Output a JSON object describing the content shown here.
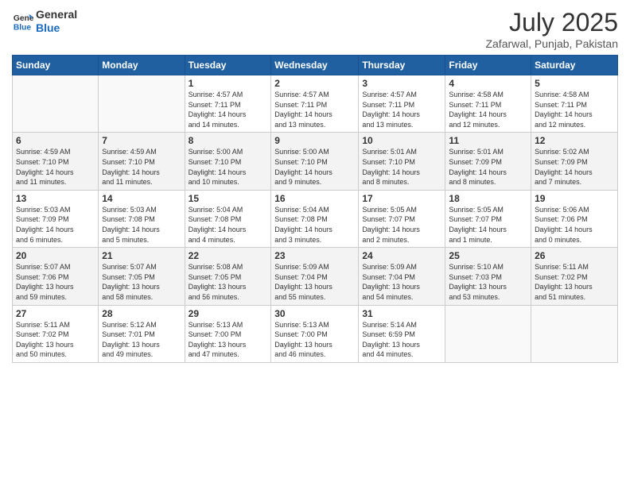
{
  "header": {
    "logo_line1": "General",
    "logo_line2": "Blue",
    "month_year": "July 2025",
    "location": "Zafarwal, Punjab, Pakistan"
  },
  "weekdays": [
    "Sunday",
    "Monday",
    "Tuesday",
    "Wednesday",
    "Thursday",
    "Friday",
    "Saturday"
  ],
  "weeks": [
    [
      {
        "day": "",
        "info": ""
      },
      {
        "day": "",
        "info": ""
      },
      {
        "day": "1",
        "info": "Sunrise: 4:57 AM\nSunset: 7:11 PM\nDaylight: 14 hours\nand 14 minutes."
      },
      {
        "day": "2",
        "info": "Sunrise: 4:57 AM\nSunset: 7:11 PM\nDaylight: 14 hours\nand 13 minutes."
      },
      {
        "day": "3",
        "info": "Sunrise: 4:57 AM\nSunset: 7:11 PM\nDaylight: 14 hours\nand 13 minutes."
      },
      {
        "day": "4",
        "info": "Sunrise: 4:58 AM\nSunset: 7:11 PM\nDaylight: 14 hours\nand 12 minutes."
      },
      {
        "day": "5",
        "info": "Sunrise: 4:58 AM\nSunset: 7:11 PM\nDaylight: 14 hours\nand 12 minutes."
      }
    ],
    [
      {
        "day": "6",
        "info": "Sunrise: 4:59 AM\nSunset: 7:10 PM\nDaylight: 14 hours\nand 11 minutes."
      },
      {
        "day": "7",
        "info": "Sunrise: 4:59 AM\nSunset: 7:10 PM\nDaylight: 14 hours\nand 11 minutes."
      },
      {
        "day": "8",
        "info": "Sunrise: 5:00 AM\nSunset: 7:10 PM\nDaylight: 14 hours\nand 10 minutes."
      },
      {
        "day": "9",
        "info": "Sunrise: 5:00 AM\nSunset: 7:10 PM\nDaylight: 14 hours\nand 9 minutes."
      },
      {
        "day": "10",
        "info": "Sunrise: 5:01 AM\nSunset: 7:10 PM\nDaylight: 14 hours\nand 8 minutes."
      },
      {
        "day": "11",
        "info": "Sunrise: 5:01 AM\nSunset: 7:09 PM\nDaylight: 14 hours\nand 8 minutes."
      },
      {
        "day": "12",
        "info": "Sunrise: 5:02 AM\nSunset: 7:09 PM\nDaylight: 14 hours\nand 7 minutes."
      }
    ],
    [
      {
        "day": "13",
        "info": "Sunrise: 5:03 AM\nSunset: 7:09 PM\nDaylight: 14 hours\nand 6 minutes."
      },
      {
        "day": "14",
        "info": "Sunrise: 5:03 AM\nSunset: 7:08 PM\nDaylight: 14 hours\nand 5 minutes."
      },
      {
        "day": "15",
        "info": "Sunrise: 5:04 AM\nSunset: 7:08 PM\nDaylight: 14 hours\nand 4 minutes."
      },
      {
        "day": "16",
        "info": "Sunrise: 5:04 AM\nSunset: 7:08 PM\nDaylight: 14 hours\nand 3 minutes."
      },
      {
        "day": "17",
        "info": "Sunrise: 5:05 AM\nSunset: 7:07 PM\nDaylight: 14 hours\nand 2 minutes."
      },
      {
        "day": "18",
        "info": "Sunrise: 5:05 AM\nSunset: 7:07 PM\nDaylight: 14 hours\nand 1 minute."
      },
      {
        "day": "19",
        "info": "Sunrise: 5:06 AM\nSunset: 7:06 PM\nDaylight: 14 hours\nand 0 minutes."
      }
    ],
    [
      {
        "day": "20",
        "info": "Sunrise: 5:07 AM\nSunset: 7:06 PM\nDaylight: 13 hours\nand 59 minutes."
      },
      {
        "day": "21",
        "info": "Sunrise: 5:07 AM\nSunset: 7:05 PM\nDaylight: 13 hours\nand 58 minutes."
      },
      {
        "day": "22",
        "info": "Sunrise: 5:08 AM\nSunset: 7:05 PM\nDaylight: 13 hours\nand 56 minutes."
      },
      {
        "day": "23",
        "info": "Sunrise: 5:09 AM\nSunset: 7:04 PM\nDaylight: 13 hours\nand 55 minutes."
      },
      {
        "day": "24",
        "info": "Sunrise: 5:09 AM\nSunset: 7:04 PM\nDaylight: 13 hours\nand 54 minutes."
      },
      {
        "day": "25",
        "info": "Sunrise: 5:10 AM\nSunset: 7:03 PM\nDaylight: 13 hours\nand 53 minutes."
      },
      {
        "day": "26",
        "info": "Sunrise: 5:11 AM\nSunset: 7:02 PM\nDaylight: 13 hours\nand 51 minutes."
      }
    ],
    [
      {
        "day": "27",
        "info": "Sunrise: 5:11 AM\nSunset: 7:02 PM\nDaylight: 13 hours\nand 50 minutes."
      },
      {
        "day": "28",
        "info": "Sunrise: 5:12 AM\nSunset: 7:01 PM\nDaylight: 13 hours\nand 49 minutes."
      },
      {
        "day": "29",
        "info": "Sunrise: 5:13 AM\nSunset: 7:00 PM\nDaylight: 13 hours\nand 47 minutes."
      },
      {
        "day": "30",
        "info": "Sunrise: 5:13 AM\nSunset: 7:00 PM\nDaylight: 13 hours\nand 46 minutes."
      },
      {
        "day": "31",
        "info": "Sunrise: 5:14 AM\nSunset: 6:59 PM\nDaylight: 13 hours\nand 44 minutes."
      },
      {
        "day": "",
        "info": ""
      },
      {
        "day": "",
        "info": ""
      }
    ]
  ]
}
